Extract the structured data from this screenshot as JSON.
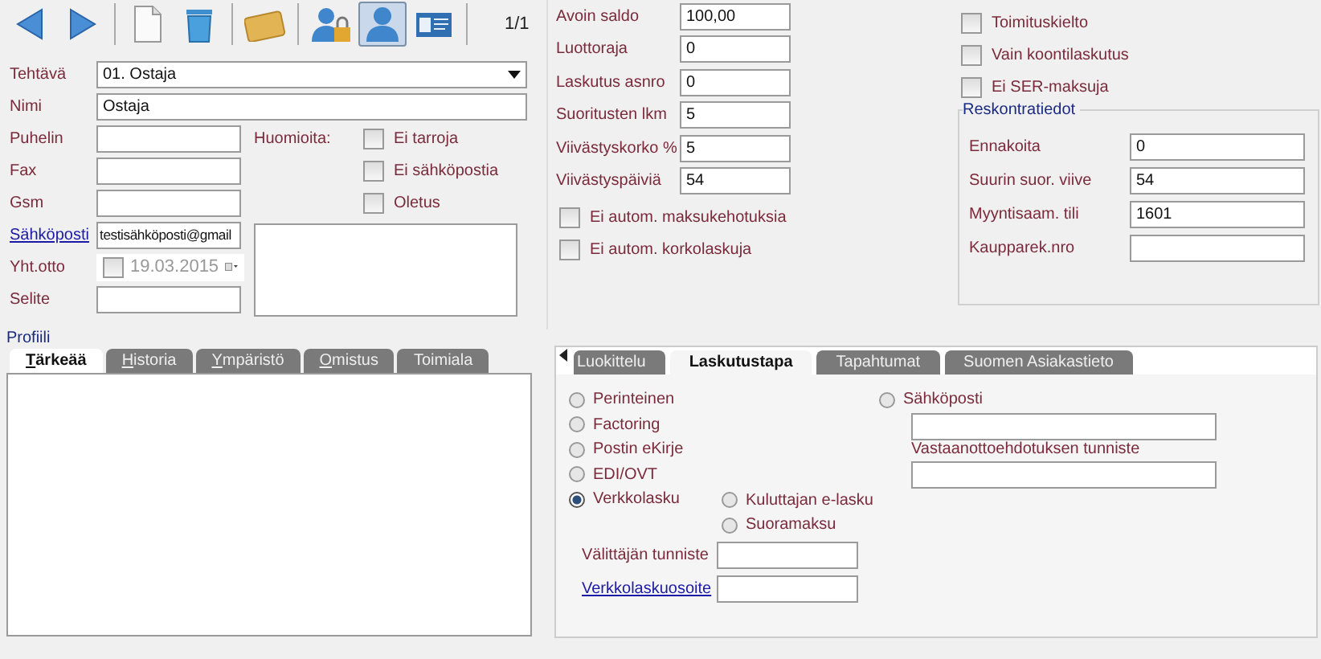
{
  "toolbar": {
    "buttons": [
      {
        "kind": "back",
        "selected": false
      },
      {
        "kind": "forward",
        "selected": false
      },
      {
        "kind": "new",
        "selected": false
      },
      {
        "kind": "delete",
        "selected": false
      },
      {
        "kind": "card",
        "selected": false
      },
      {
        "kind": "user-lock",
        "selected": false
      },
      {
        "kind": "user",
        "selected": true
      },
      {
        "kind": "id-card",
        "selected": false
      }
    ],
    "page": "1/1"
  },
  "contact": {
    "top_fields": [
      {
        "label": "Tehtävä",
        "value": "01. Ostaja",
        "kind": "dropdown"
      },
      {
        "label": "Nimi",
        "value": "Ostaja",
        "kind": "text"
      }
    ],
    "fields": [
      {
        "label": "Puhelin",
        "kind": "text"
      },
      {
        "label": "Fax",
        "kind": "text"
      },
      {
        "label": "Gsm",
        "kind": "text"
      },
      {
        "label": "Sähköposti",
        "value": "testisähköposti@gmail",
        "kind": "link"
      },
      {
        "label": "Yht.otto",
        "value": "19.03.2015",
        "kind": "date",
        "checked": false
      },
      {
        "label": "Selite",
        "kind": "text"
      }
    ],
    "notes_label": "Huomioita:",
    "checkboxes": [
      {
        "label": "Ei tarroja",
        "checked": false
      },
      {
        "label": "Ei sähköpostia",
        "checked": false
      },
      {
        "label": "Oletus",
        "checked": false
      }
    ]
  },
  "billing": {
    "fields": [
      {
        "label": "Avoin saldo",
        "value": "100,00"
      },
      {
        "label": "Luottoraja",
        "value": "0"
      },
      {
        "label": "Laskutus asnro",
        "value": "0"
      },
      {
        "label": "Suoritusten lkm",
        "value": "5"
      },
      {
        "label": "Viivästyskorko %",
        "value": "5"
      },
      {
        "label": "Viivästyspäiviä",
        "value": "54"
      }
    ],
    "checkboxes": [
      {
        "label": "Ei autom. maksukehotuksia",
        "checked": false
      },
      {
        "label": "Ei autom. korkolaskuja",
        "checked": false
      }
    ]
  },
  "flags": [
    {
      "label": "Toimituskielto",
      "checked": false
    },
    {
      "label": "Vain koontilaskutus",
      "checked": false
    },
    {
      "label": "Ei SER-maksuja",
      "checked": false
    }
  ],
  "receivables": {
    "title": "Reskontratiedot",
    "fields": [
      {
        "label": "Ennakoita",
        "value": "0"
      },
      {
        "label": "Suurin suor. viive",
        "value": "54"
      },
      {
        "label": "Myyntisaam. tili",
        "value": "1601"
      },
      {
        "label": "Kaupparek.nro"
      }
    ]
  },
  "profile": {
    "title": "Profiili",
    "tabs": [
      {
        "label": "Tärkeää",
        "selected": true,
        "mnemonic": true
      },
      {
        "label": "Historia",
        "selected": false,
        "mnemonic": true
      },
      {
        "label": "Ympäristö",
        "selected": false,
        "mnemonic": true
      },
      {
        "label": "Omistus",
        "selected": false,
        "mnemonic": true
      },
      {
        "label": "Toimiala",
        "selected": false,
        "mnemonic": false
      }
    ]
  },
  "invoicing": {
    "tabs": [
      {
        "label": "Luokittelu",
        "selected": false
      },
      {
        "label": "Laskutustapa",
        "selected": true
      },
      {
        "label": "Tapahtumat",
        "selected": false
      },
      {
        "label": "Suomen Asiakastieto",
        "selected": false
      }
    ],
    "methods": [
      {
        "label": "Perinteinen",
        "selected": false
      },
      {
        "label": "Factoring",
        "selected": false
      },
      {
        "label": "Postin eKirje",
        "selected": false
      },
      {
        "label": "EDI/OVT",
        "selected": false
      },
      {
        "label": "Verkkolasku",
        "selected": true
      }
    ],
    "einvoice_options": [
      {
        "label": "Kuluttajan e-lasku",
        "selected": false
      },
      {
        "label": "Suoramaksu",
        "selected": false
      }
    ],
    "email_option": {
      "label": "Sähköposti",
      "selected": false
    },
    "operator_label": "Välittäjän tunniste",
    "address_link": "Verkkolaskuosoite",
    "proposal_label": "Vastaanottoehdotuksen tunniste"
  }
}
